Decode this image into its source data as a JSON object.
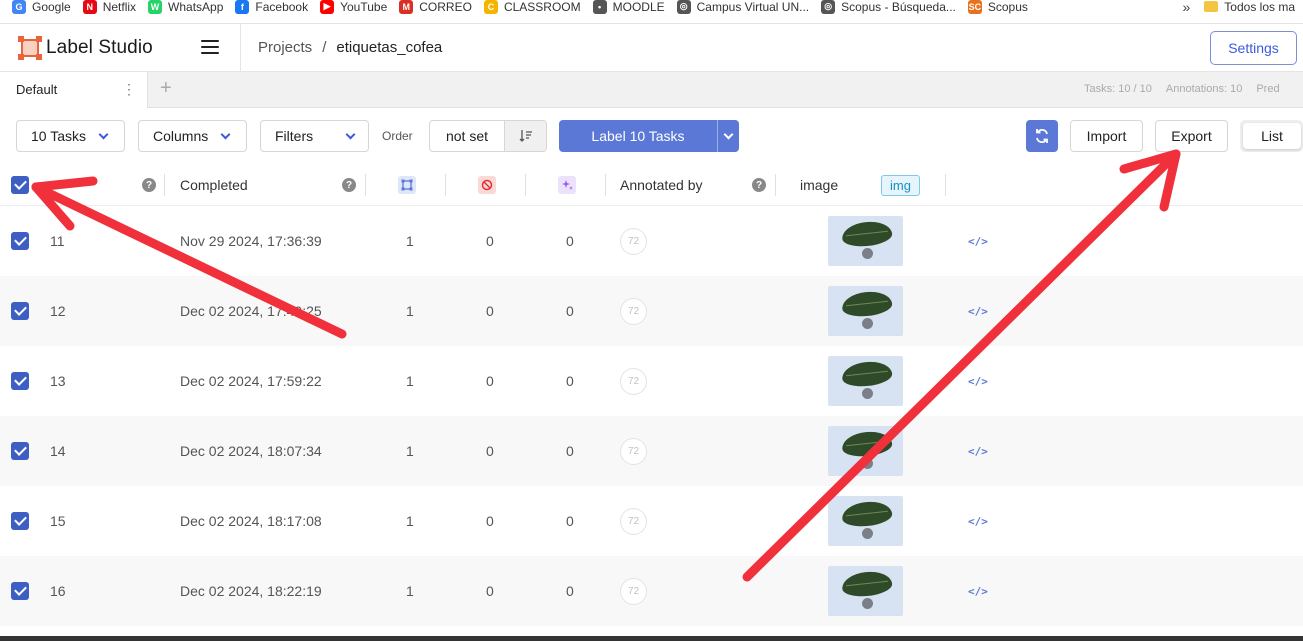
{
  "bookmarks": {
    "items": [
      {
        "label": "Google",
        "icon": "google-icon",
        "color": "#4285f4",
        "glyph": "G"
      },
      {
        "label": "Netflix",
        "icon": "netflix-icon",
        "color": "#e50914",
        "glyph": "N"
      },
      {
        "label": "WhatsApp",
        "icon": "whatsapp-icon",
        "color": "#25d366",
        "glyph": "W"
      },
      {
        "label": "Facebook",
        "icon": "facebook-icon",
        "color": "#1877f2",
        "glyph": "f"
      },
      {
        "label": "YouTube",
        "icon": "youtube-icon",
        "color": "#ff0000",
        "glyph": "▶"
      },
      {
        "label": "CORREO",
        "icon": "gmail-icon",
        "color": "#d93025",
        "glyph": "M"
      },
      {
        "label": "CLASSROOM",
        "icon": "classroom-icon",
        "color": "#f4b400",
        "glyph": "C"
      },
      {
        "label": "MOODLE",
        "icon": "moodle-icon",
        "color": "#555555",
        "glyph": "•"
      },
      {
        "label": "Campus Virtual UN...",
        "icon": "globe-icon",
        "color": "#555555",
        "glyph": "◎"
      },
      {
        "label": "Scopus - Búsqueda...",
        "icon": "globe-icon",
        "color": "#555555",
        "glyph": "◎"
      },
      {
        "label": "Scopus",
        "icon": "scopus-icon",
        "color": "#e9711c",
        "glyph": "SC"
      }
    ],
    "more": "»",
    "folder": "Todos los ma"
  },
  "app": {
    "name": "Label Studio",
    "breadcrumb": {
      "root": "Projects",
      "sep": "/",
      "current": "etiquetas_cofea"
    },
    "settings_label": "Settings"
  },
  "tabs": {
    "active": "Default",
    "add": "+",
    "stats": {
      "tasks": "Tasks: 10 / 10",
      "annotations": "Annotations: 10",
      "predictions": "Pred"
    }
  },
  "toolbar": {
    "tasks_label": "10 Tasks",
    "columns_label": "Columns",
    "filters_label": "Filters",
    "order_label": "Order",
    "order_value": "not set",
    "label_button": "Label 10 Tasks",
    "import_label": "Import",
    "export_label": "Export",
    "view_label": "List"
  },
  "columns": {
    "completed": "Completed",
    "annotated_by": "Annotated by",
    "image": "image",
    "image_tag": "img"
  },
  "rows": [
    {
      "id": "11",
      "completed": "Nov 29 2024, 17:36:39",
      "annotations": "1",
      "cancelled": "0",
      "predictions": "0",
      "annotator": "72"
    },
    {
      "id": "12",
      "completed": "Dec 02 2024, 17:49:25",
      "annotations": "1",
      "cancelled": "0",
      "predictions": "0",
      "annotator": "72"
    },
    {
      "id": "13",
      "completed": "Dec 02 2024, 17:59:22",
      "annotations": "1",
      "cancelled": "0",
      "predictions": "0",
      "annotator": "72"
    },
    {
      "id": "14",
      "completed": "Dec 02 2024, 18:07:34",
      "annotations": "1",
      "cancelled": "0",
      "predictions": "0",
      "annotator": "72"
    },
    {
      "id": "15",
      "completed": "Dec 02 2024, 18:17:08",
      "annotations": "1",
      "cancelled": "0",
      "predictions": "0",
      "annotator": "72"
    },
    {
      "id": "16",
      "completed": "Dec 02 2024, 18:22:19",
      "annotations": "1",
      "cancelled": "0",
      "predictions": "0",
      "annotator": "72"
    }
  ],
  "row_code_glyph": "</>",
  "colors": {
    "accent": "#5b78d6",
    "checkbox": "#3d5fc4",
    "annotation_arrow": "#f0303a",
    "brand": "#e8653c"
  }
}
